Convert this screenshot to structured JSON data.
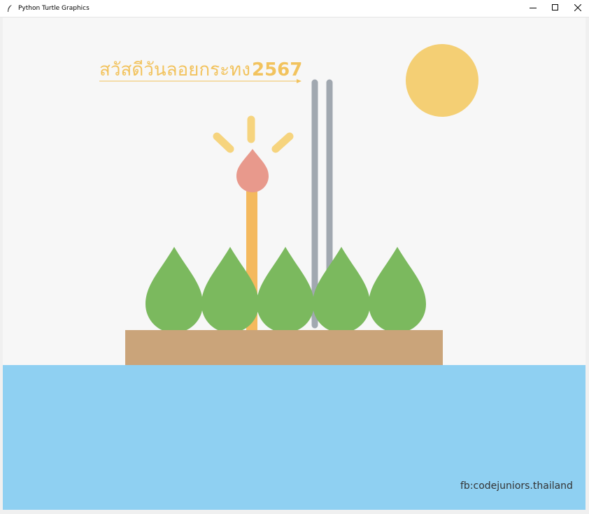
{
  "window": {
    "title": "Python Turtle Graphics",
    "app_icon": "feather-icon",
    "controls": {
      "minimize": "minimize-icon",
      "maximize": "maximize-icon",
      "close": "close-icon"
    }
  },
  "canvas": {
    "greeting_text": "สวัสดีวันลอยกระทง",
    "year_text": "2567",
    "credit_text": "fb:codejuniors.thailand",
    "colors": {
      "background": "#f7f7f7",
      "water": "#8fd0f2",
      "base": "#caa47a",
      "leaf": "#7bb95e",
      "candle": "#f4b95e",
      "flame": "#e8998c",
      "sparkle": "#f6d47e",
      "incense": "#a1a8b0",
      "sun": "#f4cf74",
      "greeting": "#f2c35e",
      "credit": "#333333"
    }
  }
}
